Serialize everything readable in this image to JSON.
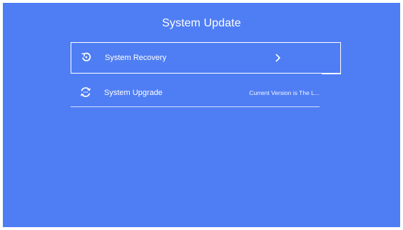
{
  "header": {
    "title": "System Update"
  },
  "menu": {
    "items": [
      {
        "label": "System Recovery",
        "icon": "recovery-icon",
        "trailing_icon": "chevron-right-icon",
        "focused": true
      },
      {
        "label": "System Upgrade",
        "icon": "upgrade-icon",
        "status": "Current Version is The L...",
        "focused": false
      }
    ]
  },
  "colors": {
    "background": "#4f7ef4",
    "text": "#ffffff",
    "frame": "#ffffff"
  }
}
